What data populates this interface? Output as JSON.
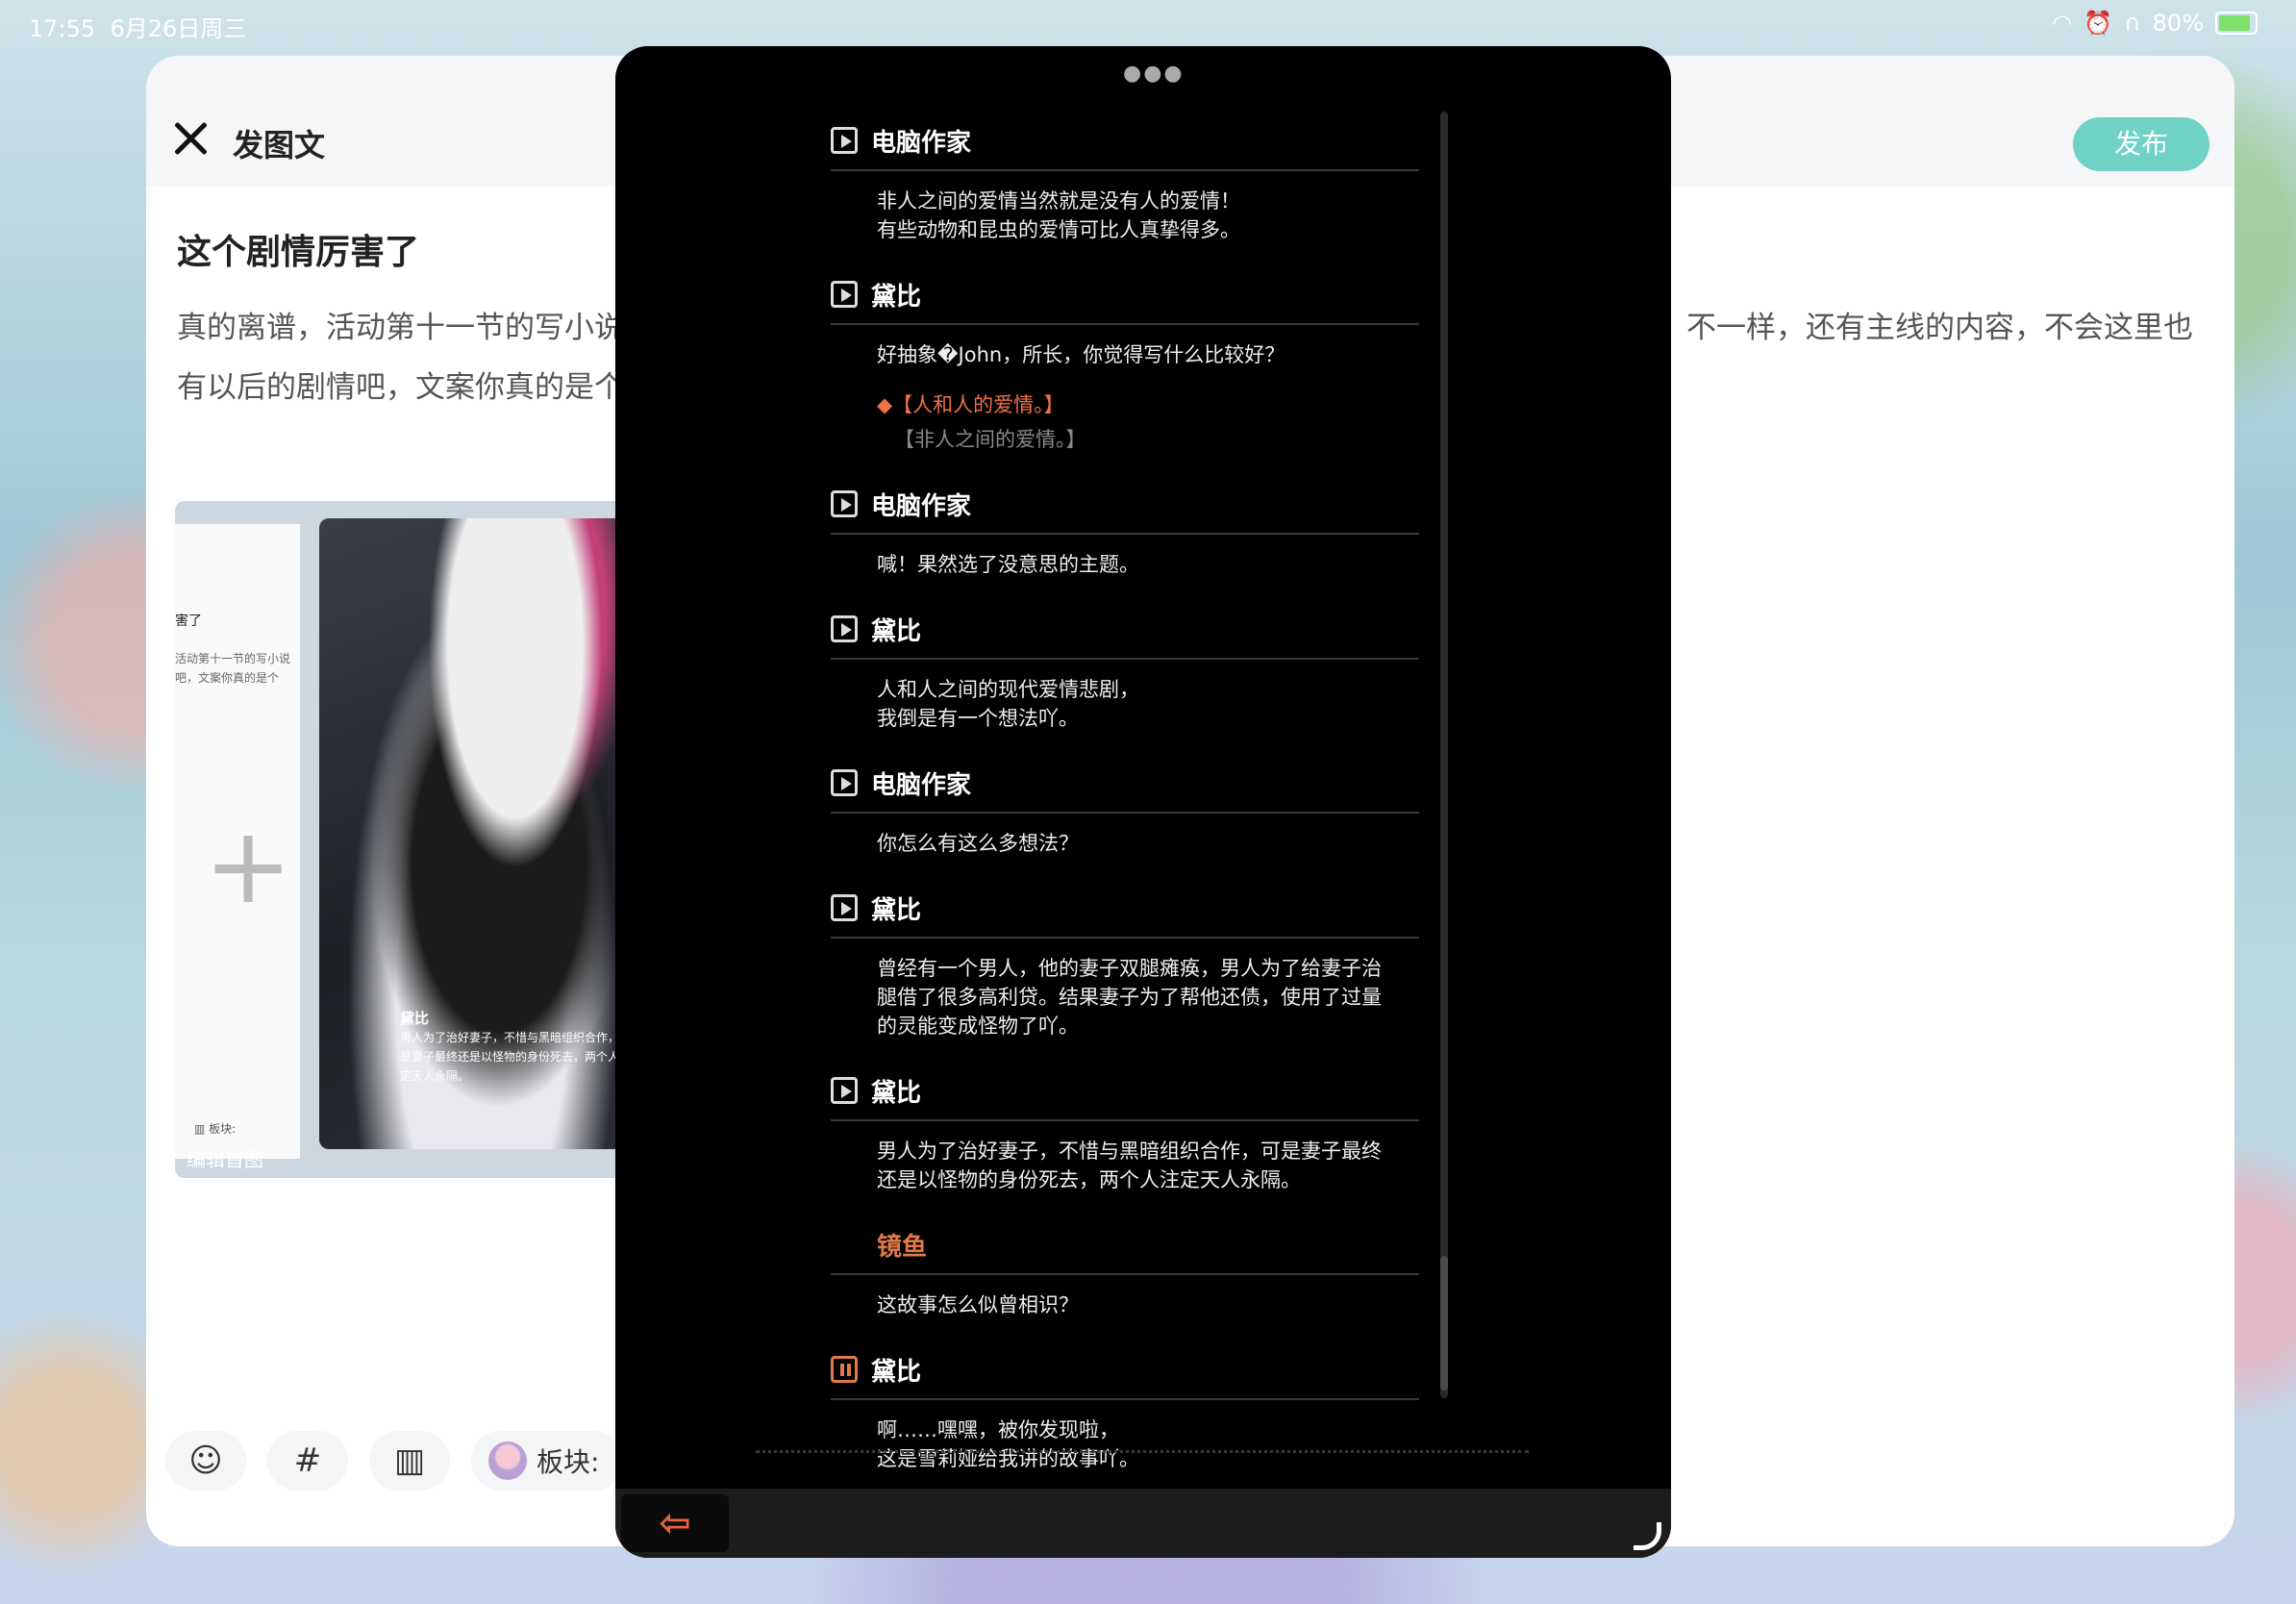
{
  "status_bar": {
    "time": "17:55",
    "date": "6月26日周三",
    "battery": "80%",
    "icons": [
      "wifi-icon",
      "alarm-icon",
      "headphones-icon"
    ]
  },
  "editor": {
    "title": "发图文",
    "publish_label": "发布",
    "post_title": "这个剧情厉害了",
    "body_line1_left": "真的离谱，活动第十一节的写小说",
    "body_line1_right": "不一样，还有主线的内容，不会这里也",
    "body_line2": "有以后的剧情吧，文案你真的是个",
    "thumb": {
      "title_snip": "害了",
      "body_snip": "活动第十一节的写小说吧，文案你真的是个",
      "edit_cover_label": "编辑首图",
      "board_snip": "板块:",
      "art_caption_name": "黛比",
      "art_caption_text": "男人为了治好妻子，不惜与黑暗组织合作，可是妻子最终还是以怪物的身份死去，两个人注定天人永隔。"
    },
    "toolbar": {
      "board_label": "板块:"
    }
  },
  "dialog_log": {
    "entries": [
      {
        "speaker": "电脑作家",
        "lines": [
          "非人之间的爱情当然就是没有人的爱情！",
          "有些动物和昆虫的爱情可比人真挚得多。"
        ]
      },
      {
        "speaker": "黛比",
        "lines": [
          "好抽象�John，所长，你觉得写什么比较好？"
        ],
        "choices": [
          "◆【人和人的爱情。】",
          "【非人之间的爱情。】"
        ]
      },
      {
        "speaker": "电脑作家",
        "lines": [
          "喊！果然选了没意思的主题。"
        ]
      },
      {
        "speaker": "黛比",
        "lines": [
          "人和人之间的现代爱情悲剧，",
          "我倒是有一个想法吖。"
        ]
      },
      {
        "speaker": "电脑作家",
        "lines": [
          "你怎么有这么多想法？"
        ]
      },
      {
        "speaker": "黛比",
        "lines": [
          "曾经有一个男人，他的妻子双腿瘫痪，男人为了给妻子治",
          "腿借了很多高利贷。结果妻子为了帮他还债，使用了过量",
          "的灵能变成怪物了吖。"
        ]
      },
      {
        "speaker": "黛比",
        "lines": [
          "男人为了治好妻子，不惜与黑暗组织合作，可是妻子最终",
          "还是以怪物的身份死去，两个人注定天人永隔。"
        ]
      },
      {
        "speaker": "镜鱼",
        "lines": [
          "这故事怎么似曾相识？"
        ]
      },
      {
        "speaker": "黛比",
        "lines": [
          "啊……嘿嘿，被你发现啦，",
          "这是雪莉娅给我讲的故事吖。"
        ]
      }
    ]
  }
}
